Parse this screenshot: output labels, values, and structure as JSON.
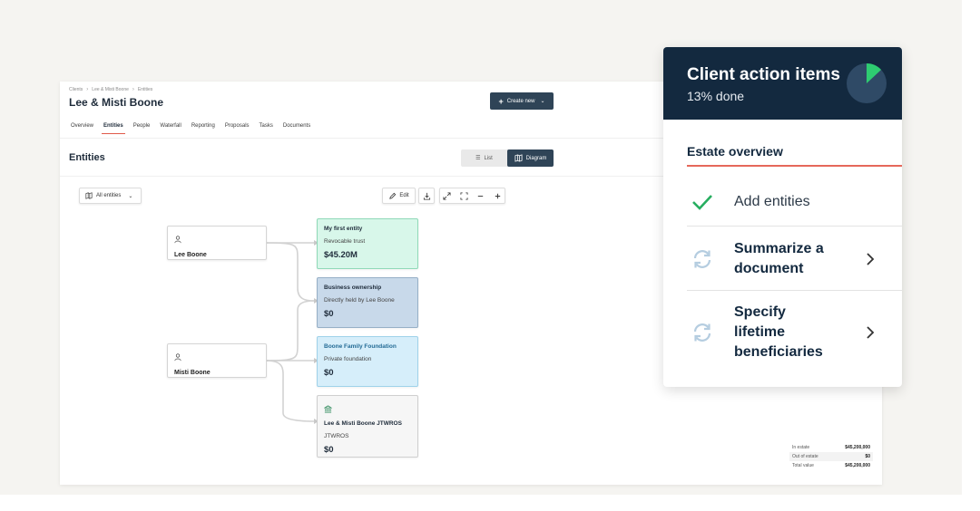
{
  "breadcrumb": [
    "Clients",
    "Lee & Misti Boone",
    "Entities"
  ],
  "page_title": "Lee & Misti Boone",
  "create_button_label": "Create new",
  "tabs": [
    {
      "label": "Overview",
      "active": false
    },
    {
      "label": "Entities",
      "active": true
    },
    {
      "label": "People",
      "active": false
    },
    {
      "label": "Waterfall",
      "active": false
    },
    {
      "label": "Reporting",
      "active": false
    },
    {
      "label": "Proposals",
      "active": false
    },
    {
      "label": "Tasks",
      "active": false
    },
    {
      "label": "Documents",
      "active": false
    }
  ],
  "section_title": "Entities",
  "view_toggle": {
    "list_label": "List",
    "diagram_label": "Diagram",
    "selected": "Diagram"
  },
  "filter_label": "All entities",
  "toolbar": {
    "edit_label": "Edit"
  },
  "people": [
    {
      "name": "Lee Boone"
    },
    {
      "name": "Misti Boone"
    }
  ],
  "entities": [
    {
      "name": "My first entity",
      "type": "Revocable trust",
      "value": "$45.20M",
      "color": "#d8f7ea",
      "border": "#8fd9b8"
    },
    {
      "name": "Business ownership",
      "type": "Directly held by Lee Boone",
      "value": "$0",
      "color": "#c8d9ea",
      "border": "#96afc7"
    },
    {
      "name": "Boone Family Foundation",
      "type": "Private foundation",
      "value": "$0",
      "color": "#d6eefa",
      "border": "#9fd2ea"
    },
    {
      "name": "Lee & Misti Boone JTWROS",
      "type": "JTWROS",
      "value": "$0",
      "color": "#f6f6f6",
      "border": "#cfcfcf"
    }
  ],
  "summary": [
    {
      "label": "In estate",
      "value": "$45,200,000"
    },
    {
      "label": "Out of estate",
      "value": "$0"
    },
    {
      "label": "Total value",
      "value": "$45,200,000"
    }
  ],
  "action_panel": {
    "title": "Client action items",
    "progress_text": "13% done",
    "progress_fraction": 0.13,
    "section_label": "Estate overview",
    "items": [
      {
        "label": "Add entities",
        "status": "done"
      },
      {
        "label": "Summarize a document",
        "status": "pending"
      },
      {
        "label": "Specify lifetime beneficiaries",
        "status": "pending"
      }
    ],
    "colors": {
      "header": "#13293f",
      "accent": "#e5685a",
      "progress": "#2ecc71",
      "check": "#27ae60"
    }
  }
}
